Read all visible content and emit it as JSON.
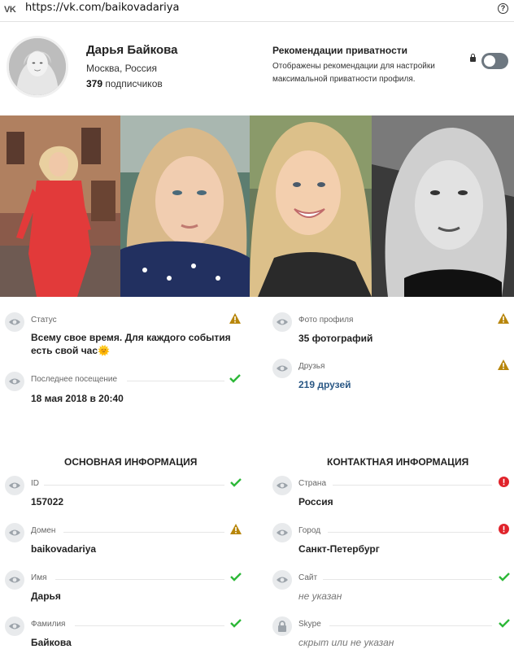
{
  "browser": {
    "url": "https://vk.com/baikovadariya",
    "logo": "VK",
    "help": "?"
  },
  "profile": {
    "name": "Дарья Байкова",
    "location": "Москва, Россия",
    "subscribers_count": "379",
    "subscribers_label": "подписчиков"
  },
  "privacy": {
    "title": "Рекомендации приватности",
    "description": "Отображены рекомендации для настройки максимальной приватности профиля.",
    "toggle_on": false
  },
  "photos": [
    {
      "icon": "photo-woman-red-dress"
    },
    {
      "icon": "photo-selfie-scarf"
    },
    {
      "icon": "photo-selfie-smile"
    },
    {
      "icon": "photo-portrait-bw"
    }
  ],
  "top_fields": {
    "status": {
      "label": "Статус",
      "value": "Всему свое время. Для каждого события есть свой час🌞",
      "indicator": "warning"
    },
    "last_seen": {
      "label": "Последнее посещение",
      "value": "18 мая 2018 в 20:40",
      "indicator": "ok"
    },
    "profile_photos": {
      "label": "Фото профиля",
      "value": "35 фотографий",
      "indicator": "warning"
    },
    "friends": {
      "label": "Друзья",
      "value": "219 друзей",
      "indicator": "warning"
    }
  },
  "basic_info": {
    "title": "ОСНОВНАЯ ИНФОРМАЦИЯ",
    "fields": [
      {
        "label": "ID",
        "value": "157022",
        "indicator": "ok"
      },
      {
        "label": "Домен",
        "value": "baikovadariya",
        "indicator": "warning"
      },
      {
        "label": "Имя",
        "value": "Дарья",
        "indicator": "ok"
      },
      {
        "label": "Фамилия",
        "value": "Байкова",
        "indicator": "ok"
      }
    ]
  },
  "contact_info": {
    "title": "КОНТАКТНАЯ ИНФОРМАЦИЯ",
    "fields": [
      {
        "label": "Страна",
        "value": "Россия",
        "indicator": "error",
        "icon": "eye-icon"
      },
      {
        "label": "Город",
        "value": "Санкт-Петербург",
        "indicator": "error",
        "icon": "eye-icon"
      },
      {
        "label": "Сайт",
        "value": "не указан",
        "indicator": "ok",
        "icon": "eye-icon"
      },
      {
        "label": "Skype",
        "value": "скрыт или не указан",
        "indicator": "ok",
        "icon": "lock-icon"
      }
    ]
  },
  "colors": {
    "ok": "#2db838",
    "warning": "#b8860b",
    "error": "#e0232b",
    "link": "#2a5885"
  }
}
